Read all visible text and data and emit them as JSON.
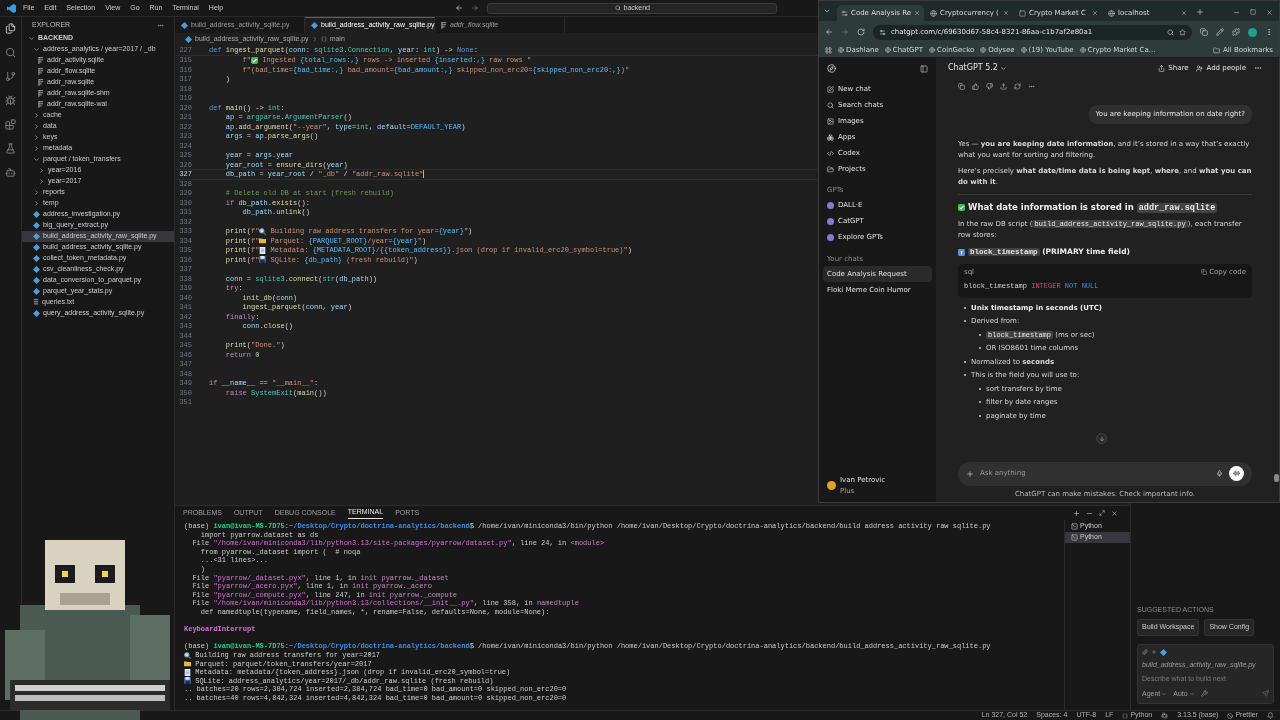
{
  "title_bar": {
    "menu": [
      "File",
      "Edit",
      "Selection",
      "View",
      "Go",
      "Run",
      "Terminal",
      "Help"
    ],
    "search": "backend"
  },
  "explorer": {
    "title": "EXPLORER",
    "root": {
      "label": "BACKEND",
      "kind": "folder",
      "expanded": true,
      "selected": false,
      "children": [
        {
          "label": "address_analytics / year=2017 / _db",
          "kind": "folder",
          "expanded": true,
          "selected": false,
          "children": [
            {
              "label": "addr_activity.sqlite",
              "kind": "database",
              "selected": false
            },
            {
              "label": "addr_flow.sqlite",
              "kind": "database",
              "selected": false
            },
            {
              "label": "addr_raw.sqlite",
              "kind": "database",
              "selected": false
            },
            {
              "label": "addr_raw.sqlite-shm",
              "kind": "database",
              "selected": false
            },
            {
              "label": "addr_raw.sqlite-wal",
              "kind": "database",
              "selected": false
            }
          ]
        },
        {
          "label": "cache",
          "kind": "folder",
          "expanded": false,
          "selected": false
        },
        {
          "label": "data",
          "kind": "folder",
          "expanded": false,
          "selected": false
        },
        {
          "label": "keys",
          "kind": "folder",
          "expanded": false,
          "selected": false
        },
        {
          "label": "metadata",
          "kind": "folder",
          "expanded": false,
          "selected": false
        },
        {
          "label": "parquet / token_transfers",
          "kind": "folder",
          "expanded": true,
          "selected": false,
          "children": [
            {
              "label": "year=2016",
              "kind": "folder",
              "expanded": false,
              "selected": false
            },
            {
              "label": "year=2017",
              "kind": "folder",
              "expanded": false,
              "selected": false
            }
          ]
        },
        {
          "label": "reports",
          "kind": "folder",
          "expanded": false,
          "selected": false
        },
        {
          "label": "temp",
          "kind": "folder",
          "expanded": false,
          "selected": false
        },
        {
          "label": "address_investigation.py",
          "kind": "python",
          "selected": false
        },
        {
          "label": "big_query_extract.py",
          "kind": "python",
          "selected": false
        },
        {
          "label": "build_address_activity_raw_sqlite.py",
          "kind": "python",
          "selected": true
        },
        {
          "label": "build_address_activity_sqlite.py",
          "kind": "python",
          "selected": false
        },
        {
          "label": "collect_token_metadata.py",
          "kind": "python",
          "selected": false
        },
        {
          "label": "csv_cleanliness_check.py",
          "kind": "python",
          "selected": false
        },
        {
          "label": "data_conversion_to_parquet.py",
          "kind": "python",
          "selected": false
        },
        {
          "label": "parquet_year_stats.py",
          "kind": "python",
          "selected": false
        },
        {
          "label": "queries.txt",
          "kind": "text",
          "selected": false
        },
        {
          "label": "query_address_activity_sqlite.py",
          "kind": "python",
          "selected": false
        }
      ]
    }
  },
  "editor": {
    "tabs": [
      {
        "label": "build_address_activity_sqlite.py",
        "kind": "python",
        "selected": false,
        "preview": false
      },
      {
        "label": "build_address_activity_raw_sqlite.py",
        "kind": "python",
        "selected": true,
        "preview": false
      },
      {
        "label": "addr_flow.sqlite",
        "kind": "database",
        "selected": false,
        "preview": true
      }
    ],
    "breadcrumb": [
      "build_address_activity_raw_sqlite.py",
      "main"
    ],
    "lines": [
      {
        "number": "227",
        "current": false,
        "tokens": [
          {
            "kind": "kw",
            "text": "def "
          },
          {
            "kind": "fn",
            "text": "ingest_parquet"
          },
          {
            "kind": "p",
            "text": "("
          },
          {
            "kind": "var",
            "text": "conn"
          },
          {
            "kind": "p",
            "text": ": "
          },
          {
            "kind": "cls",
            "text": "sqlite3"
          },
          {
            "kind": "p",
            "text": "."
          },
          {
            "kind": "cls",
            "text": "Connection"
          },
          {
            "kind": "p",
            "text": ", "
          },
          {
            "kind": "var",
            "text": "year"
          },
          {
            "kind": "p",
            "text": ": "
          },
          {
            "kind": "cls",
            "text": "int"
          },
          {
            "kind": "p",
            "text": ") -> "
          },
          {
            "kind": "kw",
            "text": "None"
          },
          {
            "kind": "p",
            "text": ":"
          }
        ]
      },
      {
        "number": "315",
        "current": false,
        "tokens": [
          {
            "kind": "str",
            "text": "        f\""
          },
          {
            "kind": "check"
          },
          {
            "kind": "str",
            "text": " Ingested "
          },
          {
            "kind": "const",
            "text": "{total_rows:,}"
          },
          {
            "kind": "str",
            "text": " rows -> inserted "
          },
          {
            "kind": "const",
            "text": "{inserted:,}"
          },
          {
            "kind": "str",
            "text": " raw rows \""
          }
        ]
      },
      {
        "number": "316",
        "current": false,
        "tokens": [
          {
            "kind": "str",
            "text": "        f\"(bad_time="
          },
          {
            "kind": "const",
            "text": "{bad_time:,}"
          },
          {
            "kind": "str",
            "text": " bad_amount="
          },
          {
            "kind": "const",
            "text": "{bad_amount:,}"
          },
          {
            "kind": "str",
            "text": " skipped_non_erc20="
          },
          {
            "kind": "const",
            "text": "{skipped_non_erc20:,}"
          },
          {
            "kind": "str",
            "text": ")\""
          }
        ]
      },
      {
        "number": "317",
        "current": false,
        "tokens": [
          {
            "kind": "p",
            "text": "    )"
          }
        ]
      },
      {
        "number": "318",
        "current": false
      },
      {
        "number": "319",
        "current": false
      },
      {
        "number": "320",
        "current": false,
        "tokens": [
          {
            "kind": "kw",
            "text": "def "
          },
          {
            "kind": "fn",
            "text": "main"
          },
          {
            "kind": "p",
            "text": "() -> "
          },
          {
            "kind": "cls",
            "text": "int"
          },
          {
            "kind": "p",
            "text": ":"
          }
        ]
      },
      {
        "number": "321",
        "current": false,
        "tokens": [
          {
            "kind": "var",
            "text": "    ap"
          },
          {
            "kind": "p",
            "text": " = "
          },
          {
            "kind": "cls",
            "text": "argparse"
          },
          {
            "kind": "p",
            "text": "."
          },
          {
            "kind": "cls",
            "text": "ArgumentParser"
          },
          {
            "kind": "p",
            "text": "()"
          }
        ]
      },
      {
        "number": "322",
        "current": false,
        "tokens": [
          {
            "kind": "var",
            "text": "    ap"
          },
          {
            "kind": "p",
            "text": "."
          },
          {
            "kind": "fn",
            "text": "add_argument"
          },
          {
            "kind": "p",
            "text": "("
          },
          {
            "kind": "str",
            "text": "\"--year\""
          },
          {
            "kind": "p",
            "text": ", "
          },
          {
            "kind": "var",
            "text": "type"
          },
          {
            "kind": "p",
            "text": "="
          },
          {
            "kind": "cls",
            "text": "int"
          },
          {
            "kind": "p",
            "text": ", "
          },
          {
            "kind": "var",
            "text": "default"
          },
          {
            "kind": "p",
            "text": "="
          },
          {
            "kind": "const",
            "text": "DEFAULT_YEAR"
          },
          {
            "kind": "p",
            "text": ")"
          }
        ]
      },
      {
        "number": "323",
        "current": false,
        "tokens": [
          {
            "kind": "var",
            "text": "    args"
          },
          {
            "kind": "p",
            "text": " = "
          },
          {
            "kind": "var",
            "text": "ap"
          },
          {
            "kind": "p",
            "text": "."
          },
          {
            "kind": "fn",
            "text": "parse_args"
          },
          {
            "kind": "p",
            "text": "()"
          }
        ]
      },
      {
        "number": "324",
        "current": false
      },
      {
        "number": "325",
        "current": false,
        "tokens": [
          {
            "kind": "var",
            "text": "    year"
          },
          {
            "kind": "p",
            "text": " = "
          },
          {
            "kind": "var",
            "text": "args"
          },
          {
            "kind": "p",
            "text": "."
          },
          {
            "kind": "var",
            "text": "year"
          }
        ]
      },
      {
        "number": "326",
        "current": false,
        "tokens": [
          {
            "kind": "var",
            "text": "    year_root"
          },
          {
            "kind": "p",
            "text": " = "
          },
          {
            "kind": "fn",
            "text": "ensure_dirs"
          },
          {
            "kind": "p",
            "text": "("
          },
          {
            "kind": "var",
            "text": "year"
          },
          {
            "kind": "p",
            "text": ")"
          }
        ]
      },
      {
        "number": "327",
        "current": true,
        "tokens": [
          {
            "kind": "var",
            "text": "    db_path"
          },
          {
            "kind": "p",
            "text": " = "
          },
          {
            "kind": "var",
            "text": "year_root"
          },
          {
            "kind": "p",
            "text": " / "
          },
          {
            "kind": "str",
            "text": "\"_db\""
          },
          {
            "kind": "p",
            "text": " / "
          },
          {
            "kind": "str",
            "text": "\"addr_raw.sqlite\""
          }
        ]
      },
      {
        "number": "328",
        "current": false
      },
      {
        "number": "329",
        "current": false,
        "tokens": [
          {
            "kind": "cm",
            "text": "    # Delete old DB at start (fresh rebuild)"
          }
        ]
      },
      {
        "number": "330",
        "current": false,
        "tokens": [
          {
            "kind": "ctl",
            "text": "    if "
          },
          {
            "kind": "var",
            "text": "db_path"
          },
          {
            "kind": "p",
            "text": "."
          },
          {
            "kind": "fn",
            "text": "exists"
          },
          {
            "kind": "p",
            "text": "():"
          }
        ]
      },
      {
        "number": "331",
        "current": false,
        "tokens": [
          {
            "kind": "var",
            "text": "        db_path"
          },
          {
            "kind": "p",
            "text": "."
          },
          {
            "kind": "fn",
            "text": "unlink"
          },
          {
            "kind": "p",
            "text": "()"
          }
        ]
      },
      {
        "number": "332",
        "current": false
      },
      {
        "number": "333",
        "current": false,
        "tokens": [
          {
            "kind": "fn",
            "text": "    print"
          },
          {
            "kind": "p",
            "text": "("
          },
          {
            "kind": "str",
            "text": "f\""
          },
          {
            "kind": "magnifier"
          },
          {
            "kind": "str",
            "text": " Building raw address transfers for year="
          },
          {
            "kind": "const",
            "text": "{year}"
          },
          {
            "kind": "str",
            "text": "\""
          },
          {
            "kind": "p",
            "text": ")"
          }
        ]
      },
      {
        "number": "334",
        "current": false,
        "tokens": [
          {
            "kind": "fn",
            "text": "    print"
          },
          {
            "kind": "p",
            "text": "("
          },
          {
            "kind": "str",
            "text": "f\""
          },
          {
            "kind": "folder"
          },
          {
            "kind": "str",
            "text": " Parquet: "
          },
          {
            "kind": "const",
            "text": "{PARQUET_ROOT}"
          },
          {
            "kind": "str",
            "text": "/year="
          },
          {
            "kind": "const",
            "text": "{year}"
          },
          {
            "kind": "str",
            "text": "\""
          },
          {
            "kind": "p",
            "text": ")"
          }
        ]
      },
      {
        "number": "335",
        "current": false,
        "tokens": [
          {
            "kind": "fn",
            "text": "    print"
          },
          {
            "kind": "p",
            "text": "("
          },
          {
            "kind": "str",
            "text": "f\""
          },
          {
            "kind": "document"
          },
          {
            "kind": "str",
            "text": " Metadata: "
          },
          {
            "kind": "const",
            "text": "{METADATA_ROOT}"
          },
          {
            "kind": "str",
            "text": "/"
          },
          {
            "kind": "const",
            "text": "{{token_address}}"
          },
          {
            "kind": "str",
            "text": ".json (drop if invalid_erc20_symbol=true)\""
          },
          {
            "kind": "p",
            "text": ")"
          }
        ]
      },
      {
        "number": "336",
        "current": false,
        "tokens": [
          {
            "kind": "fn",
            "text": "    print"
          },
          {
            "kind": "p",
            "text": "("
          },
          {
            "kind": "str",
            "text": "f\""
          },
          {
            "kind": "disk"
          },
          {
            "kind": "str",
            "text": " SQLite: "
          },
          {
            "kind": "const",
            "text": "{db_path}"
          },
          {
            "kind": "str",
            "text": " (fresh rebuild)\""
          },
          {
            "kind": "p",
            "text": ")"
          }
        ]
      },
      {
        "number": "337",
        "current": false
      },
      {
        "number": "338",
        "current": false,
        "tokens": [
          {
            "kind": "var",
            "text": "    conn"
          },
          {
            "kind": "p",
            "text": " = "
          },
          {
            "kind": "cls",
            "text": "sqlite3"
          },
          {
            "kind": "p",
            "text": "."
          },
          {
            "kind": "fn",
            "text": "connect"
          },
          {
            "kind": "p",
            "text": "("
          },
          {
            "kind": "cls",
            "text": "str"
          },
          {
            "kind": "p",
            "text": "("
          },
          {
            "kind": "var",
            "text": "db_path"
          },
          {
            "kind": "p",
            "text": "))"
          }
        ]
      },
      {
        "number": "339",
        "current": false,
        "tokens": [
          {
            "kind": "ctl",
            "text": "    try"
          },
          {
            "kind": "p",
            "text": ":"
          }
        ]
      },
      {
        "number": "340",
        "current": false,
        "tokens": [
          {
            "kind": "fn",
            "text": "        init_db"
          },
          {
            "kind": "p",
            "text": "("
          },
          {
            "kind": "var",
            "text": "conn"
          },
          {
            "kind": "p",
            "text": ")"
          }
        ]
      },
      {
        "number": "341",
        "current": false,
        "tokens": [
          {
            "kind": "fn",
            "text": "        ingest_parquet"
          },
          {
            "kind": "p",
            "text": "("
          },
          {
            "kind": "var",
            "text": "conn"
          },
          {
            "kind": "p",
            "text": ", "
          },
          {
            "kind": "var",
            "text": "year"
          },
          {
            "kind": "p",
            "text": ")"
          }
        ]
      },
      {
        "number": "342",
        "current": false,
        "tokens": [
          {
            "kind": "ctl",
            "text": "    finally"
          },
          {
            "kind": "p",
            "text": ":"
          }
        ]
      },
      {
        "number": "343",
        "current": false,
        "tokens": [
          {
            "kind": "var",
            "text": "        conn"
          },
          {
            "kind": "p",
            "text": "."
          },
          {
            "kind": "fn",
            "text": "close"
          },
          {
            "kind": "p",
            "text": "()"
          }
        ]
      },
      {
        "number": "344",
        "current": false
      },
      {
        "number": "345",
        "current": false,
        "tokens": [
          {
            "kind": "fn",
            "text": "    print"
          },
          {
            "kind": "p",
            "text": "("
          },
          {
            "kind": "str",
            "text": "\"Done.\""
          },
          {
            "kind": "p",
            "text": ")"
          }
        ]
      },
      {
        "number": "346",
        "current": false,
        "tokens": [
          {
            "kind": "ctl",
            "text": "    return "
          },
          {
            "kind": "num",
            "text": "0"
          }
        ]
      },
      {
        "number": "347",
        "current": false
      },
      {
        "number": "348",
        "current": false
      },
      {
        "number": "349",
        "current": false,
        "tokens": [
          {
            "kind": "ctl",
            "text": "if "
          },
          {
            "kind": "var",
            "text": "__name__"
          },
          {
            "kind": "p",
            "text": " == "
          },
          {
            "kind": "str",
            "text": "\"__main__\""
          },
          {
            "kind": "p",
            "text": ":"
          }
        ]
      },
      {
        "number": "350",
        "current": false,
        "tokens": [
          {
            "kind": "ctl",
            "text": "    raise "
          },
          {
            "kind": "cls",
            "text": "SystemExit"
          },
          {
            "kind": "p",
            "text": "("
          },
          {
            "kind": "fn",
            "text": "main"
          },
          {
            "kind": "p",
            "text": "())"
          }
        ]
      },
      {
        "number": "351",
        "current": false
      }
    ]
  },
  "panel": {
    "tabs": [
      {
        "label": "PROBLEMS",
        "selected": false
      },
      {
        "label": "OUTPUT",
        "selected": false
      },
      {
        "label": "DEBUG CONSOLE",
        "selected": false
      },
      {
        "label": "TERMINAL",
        "selected": true
      },
      {
        "label": "PORTS",
        "selected": false
      }
    ],
    "terminal_lines": [
      {
        "segments": [
          {
            "kind": "plain",
            "text": "(base) "
          },
          {
            "kind": "user",
            "text": "ivan@ivan-MS-7D75"
          },
          {
            "kind": "plain",
            "text": ":"
          },
          {
            "kind": "path",
            "text": "~/Desktop/Crypto/doctrina-analytics/backend"
          },
          {
            "kind": "plain",
            "text": "$ /home/ivan/miniconda3/bin/python /home/ivan/Desktop/Crypto/doctrina-analytics/backend/build address activity raw sqlite.py"
          }
        ]
      },
      {
        "segments": [
          {
            "kind": "plain",
            "text": "    import pyarrow.dataset as ds"
          }
        ]
      },
      {
        "segments": [
          {
            "kind": "plain",
            "text": "  File "
          },
          {
            "kind": "file",
            "text": "\"/home/ivan/miniconda3/lib/python3.13/site-packages/pyarrow/dataset.py\""
          },
          {
            "kind": "plain",
            "text": ", line "
          },
          {
            "kind": "num",
            "text": "24"
          },
          {
            "kind": "plain",
            "text": ", in "
          },
          {
            "kind": "module",
            "text": "<module>"
          }
        ]
      },
      {
        "segments": [
          {
            "kind": "plain",
            "text": "    from pyarrow._dataset import (  # noqa"
          }
        ]
      },
      {
        "segments": [
          {
            "kind": "plain",
            "text": "    ...<31 lines>..."
          }
        ]
      },
      {
        "segments": [
          {
            "kind": "plain",
            "text": "    )"
          }
        ]
      },
      {
        "segments": [
          {
            "kind": "plain",
            "text": "  File "
          },
          {
            "kind": "file",
            "text": "\"pyarrow/_dataset.pyx\""
          },
          {
            "kind": "plain",
            "text": ", line "
          },
          {
            "kind": "num",
            "text": "1"
          },
          {
            "kind": "plain",
            "text": ", in "
          },
          {
            "kind": "module",
            "text": "init pyarrow._dataset"
          }
        ]
      },
      {
        "segments": [
          {
            "kind": "plain",
            "text": "  File "
          },
          {
            "kind": "file",
            "text": "\"pyarrow/_acero.pyx\""
          },
          {
            "kind": "plain",
            "text": ", line "
          },
          {
            "kind": "num",
            "text": "1"
          },
          {
            "kind": "plain",
            "text": ", in "
          },
          {
            "kind": "module",
            "text": "init pyarrow._acero"
          }
        ]
      },
      {
        "segments": [
          {
            "kind": "plain",
            "text": "  File "
          },
          {
            "kind": "file",
            "text": "\"pyarrow/_compute.pyx\""
          },
          {
            "kind": "plain",
            "text": ", line "
          },
          {
            "kind": "num",
            "text": "247"
          },
          {
            "kind": "plain",
            "text": ", in "
          },
          {
            "kind": "module",
            "text": "init pyarrow._compute"
          }
        ]
      },
      {
        "segments": [
          {
            "kind": "plain",
            "text": "  File "
          },
          {
            "kind": "file",
            "text": "\"/home/ivan/miniconda3/lib/python3.13/collections/__init__.py\""
          },
          {
            "kind": "plain",
            "text": ", line "
          },
          {
            "kind": "num",
            "text": "358"
          },
          {
            "kind": "plain",
            "text": ", in "
          },
          {
            "kind": "module",
            "text": "namedtuple"
          }
        ]
      },
      {
        "segments": [
          {
            "kind": "plain",
            "text": "    def namedtuple(typename, field_names, *, rename=False, defaults=None, module=None):"
          }
        ]
      },
      {
        "gap_before": true,
        "segments": [
          {
            "kind": "error",
            "text": "KeyboardInterrupt"
          }
        ]
      },
      {
        "gap_before": true,
        "segments": [
          {
            "kind": "plain",
            "text": "(base) "
          },
          {
            "kind": "user",
            "text": "ivan@ivan-MS-7D75"
          },
          {
            "kind": "plain",
            "text": ":"
          },
          {
            "kind": "path",
            "text": "~/Desktop/Crypto/doctrina-analytics/backend"
          },
          {
            "kind": "plain",
            "text": "$ /home/ivan/miniconda3/bin/python /home/ivan/Desktop/Crypto/doctrina-analytics/backend/build_address_activity_raw_sqlite.py"
          }
        ]
      },
      {
        "segments": [
          {
            "kind": "magnifier"
          },
          {
            "kind": "plain",
            "text": " Building raw address transfers for year=2017"
          }
        ]
      },
      {
        "segments": [
          {
            "kind": "folder"
          },
          {
            "kind": "plain",
            "text": " Parquet: parquet/token_transfers/year=2017"
          }
        ]
      },
      {
        "segments": [
          {
            "kind": "document"
          },
          {
            "kind": "plain",
            "text": " Metadata: metadata/{token_address}.json (drop if invalid_erc20_symbol=true)"
          }
        ]
      },
      {
        "segments": [
          {
            "kind": "disk"
          },
          {
            "kind": "plain",
            "text": " SQLite: address_analytics/year=2017/_db/addr_raw.sqlite (fresh rebuild)"
          }
        ]
      },
      {
        "segments": [
          {
            "kind": "plain",
            "text": ".. batches=20 rows=2,384,724 inserted=2,384,724 bad_time=0 bad_amount=0 skipped_non_erc20=0"
          }
        ]
      },
      {
        "segments": [
          {
            "kind": "plain",
            "text": ".. batches=40 rows=4,842,324 inserted=4,842,324 bad_time=0 bad_amount=0 skipped_non_erc20=0"
          }
        ]
      }
    ],
    "terminals": [
      {
        "label": "Python",
        "selected": false
      },
      {
        "label": "Python",
        "selected": true
      }
    ]
  },
  "assistant_panel": {
    "heading": "SUGGESTED ACTIONS",
    "actions": [
      "Build Workspace",
      "Show Config"
    ],
    "context_file": "build_address_activity_raw_sqlite.py",
    "placeholder": "Describe what to build next",
    "mode": "Agent",
    "model": "Auto"
  },
  "status_bar": {
    "position": "Ln 327, Col 52",
    "indent": "Spaces: 4",
    "encoding": "UTF-8",
    "eol": "LF",
    "language": "Python",
    "interpreter": "3.13.5 (base)",
    "formatter": "Prettier"
  },
  "browser": {
    "tabs": [
      {
        "title": "Code Analysis Re",
        "selected": true
      },
      {
        "title": "Cryptocurrency (",
        "selected": false
      },
      {
        "title": "Crypto Market C",
        "selected": false
      },
      {
        "title": "localhost",
        "selected": false
      }
    ],
    "url": "chatgpt.com/c/69630d67-58c4-8321-86aa-c1b7af2e80a1",
    "bookmarks": [
      "Dashlane",
      "ChatGPT",
      "CoinGecko",
      "Odysee",
      "(19) YouTube",
      "Crypto Market Ca..."
    ],
    "all_bookmarks": "All Bookmarks",
    "chat": {
      "nav": [
        "New chat",
        "Search chats",
        "Images",
        "Apps",
        "Codex",
        "Projects"
      ],
      "gpts_heading": "GPTs",
      "gpts": [
        "DALL·E",
        "CatGPT",
        "Explore GPTs"
      ],
      "chats_heading": "Your chats",
      "chats": [
        {
          "title": "Code Analysis Request",
          "selected": true
        },
        {
          "title": "Floki Meme Coin Humor",
          "selected": false
        }
      ],
      "user": {
        "name": "Ivan Petrovic",
        "plan": "Plus"
      },
      "model": "ChatGPT 5.2",
      "share": "Share",
      "add_people": "Add people",
      "user_message": "You are keeping information on date right?",
      "answer": [
        {
          "kind": "paragraph",
          "parts": [
            {
              "kind": "text",
              "text": "Yes — **you are keeping date information**, and it’s stored in a way that’s exactly what you want for sorting and filtering."
            }
          ]
        },
        {
          "kind": "paragraph",
          "parts": [
            {
              "kind": "text",
              "text": "Here’s precisely **what date/time data is being kept**, **where**, and **what you can do with it**."
            }
          ]
        },
        {
          "kind": "rule"
        },
        {
          "kind": "heading",
          "parts": [
            {
              "kind": "text",
              "text": "What date information is stored in "
            },
            {
              "kind": "code",
              "text": "addr_raw.sqlite"
            }
          ]
        },
        {
          "kind": "paragraph",
          "parts": [
            {
              "kind": "text",
              "text": "In the raw DB script ("
            },
            {
              "kind": "code",
              "text": "build_address_activity_raw_sqlite.py"
            },
            {
              "kind": "text",
              "text": "), each transfer row stores:"
            }
          ]
        },
        {
          "kind": "subheading",
          "parts": [
            {
              "kind": "code",
              "text": "block_timestamp"
            },
            {
              "kind": "text",
              "text": " (PRIMARY time field)"
            }
          ]
        },
        {
          "kind": "code_block",
          "language": "sql",
          "copy": "Copy code",
          "tokens": [
            {
              "kind": "plain",
              "text": "block_timestamp "
            },
            {
              "kind": "type",
              "text": "INTEGER"
            },
            {
              "kind": "keyword",
              "text": " NOT NULL"
            }
          ]
        },
        {
          "kind": "list",
          "items": [
            {
              "parts": [
                {
                  "kind": "strong",
                  "text": "Unix timestamp in seconds (UTC)"
                }
              ]
            },
            {
              "parts": [
                {
                  "kind": "text",
                  "text": "Derived from:"
                }
              ],
              "children": [
                {
                  "parts": [
                    {
                      "kind": "code",
                      "text": "block_timestamp"
                    },
                    {
                      "kind": "text",
                      "text": " (ms or sec)"
                    }
                  ]
                },
                {
                  "parts": [
                    {
                      "kind": "text",
                      "text": "OR ISO8601 time columns"
                    }
                  ]
                }
              ]
            },
            {
              "parts": [
                {
                  "kind": "text",
                  "text": "Normalized to **seconds**"
                }
              ]
            },
            {
              "parts": [
                {
                  "kind": "text",
                  "text": "This is the field you will use to:"
                }
              ],
              "children": [
                {
                  "parts": [
                    {
                      "kind": "text",
                      "text": "sort transfers by time"
                    }
                  ]
                },
                {
                  "parts": [
                    {
                      "kind": "text",
                      "text": "filter by date ranges"
                    }
                  ]
                },
                {
                  "parts": [
                    {
                      "kind": "text",
                      "text": "paginate by time"
                    }
                  ]
                }
              ]
            }
          ]
        }
      ],
      "composer_placeholder": "Ask anything",
      "disclaimer": "ChatGPT can make mistakes. Check important info."
    }
  }
}
